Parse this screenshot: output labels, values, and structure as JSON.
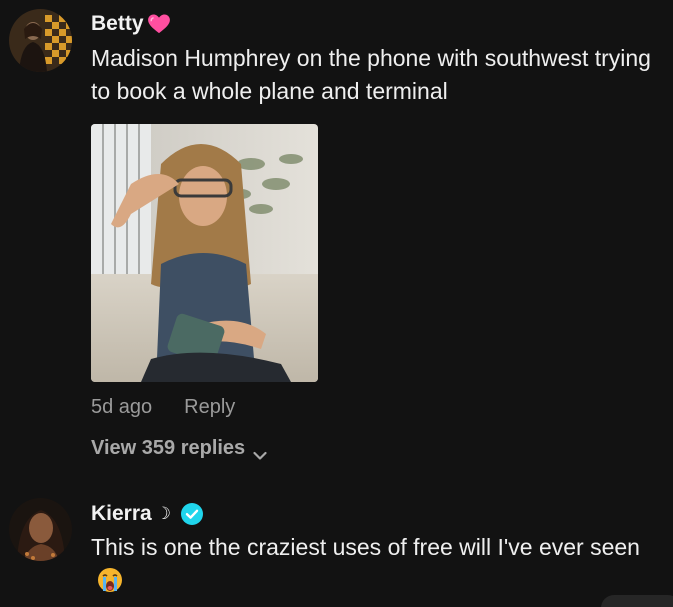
{
  "comments": [
    {
      "username": "Betty",
      "username_emoji": "pink-heart",
      "text": "Madison Humphrey on the phone with southwest trying to book a whole plane and terminal",
      "time": "5d ago",
      "reply_label": "Reply",
      "view_replies": "View 359 replies"
    },
    {
      "username": "Kierra",
      "username_suffix": "☽",
      "verified": true,
      "text": "This is one the craziest uses of free will I've ever seen",
      "text_emoji": "crying-face"
    }
  ],
  "colors": {
    "background": "#121212",
    "verified": "#20d5ec",
    "heart": "#ff4fa0",
    "meta": "#9a9a9a"
  }
}
